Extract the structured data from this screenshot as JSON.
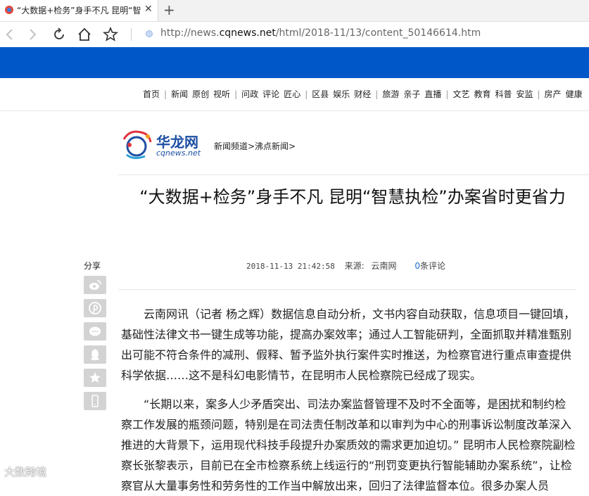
{
  "browser": {
    "tab_title": "“大数据+检务”身手不凡 昆明“智",
    "url_prefix": "http://news.",
    "url_domain": "cqnews.net",
    "url_path": "/html/2018-11/13/content_50146614.htm"
  },
  "nav": {
    "groups": [
      [
        "首页"
      ],
      [
        "新闻",
        "原创",
        "视听"
      ],
      [
        "问政",
        "评论",
        "匠心"
      ],
      [
        "区县",
        "娱乐",
        "财经"
      ],
      [
        "旅游",
        "亲子",
        "直播"
      ],
      [
        "文艺",
        "教育",
        "科普",
        "安监"
      ],
      [
        "房产",
        "健康"
      ]
    ]
  },
  "logo": {
    "text": "华龙网",
    "sub": "cqnews.net"
  },
  "breadcrumb": "新闻频道>沸点新闻>",
  "article": {
    "title": "“大数据+检务”身手不凡 昆明“智慧执检”办案省时更省力",
    "date": "2018-11-13 21:42:58",
    "source_label": "来源:",
    "source": "云南网",
    "comment_count": "0",
    "comment_label": "条评论",
    "paragraphs": [
      "云南网讯（记者 杨之辉）数据信息自动分析，文书内容自动获取，信息项目一键回填，基础性法律文书一键生成等功能，提高办案效率；通过人工智能研判，全面抓取并精准甄别出可能不符合条件的减刑、假释、暂予监外执行案件实时推送，为检察官进行重点审查提供科学依据……这不是科幻电影情节，在昆明市人民检察院已经成了现实。",
      "“长期以来，案多人少矛盾突出、司法办案监督管理不及时不全面等，是困扰和制约检察工作发展的瓶颈问题，特别是在司法责任制改革和以审判为中心的刑事诉讼制度改革深入推进的大背景下，运用现代科技手段提升办案质效的需求更加迫切。” 昆明市人民检察院副检察长张黎表示，目前已在全市检察系统上线运行的“刑罚变更执行智能辅助办案系统”，让检察官从大量事务性和劳务性的工作当中解放出来，回归了法律监督本位。很多办案人员"
    ]
  },
  "share": {
    "label": "分享",
    "buttons": [
      "weibo-icon",
      "pinterest-icon",
      "wechat-icon",
      "qq-icon",
      "star-icon",
      "mobile-icon"
    ]
  },
  "watermark": "大数跨境"
}
